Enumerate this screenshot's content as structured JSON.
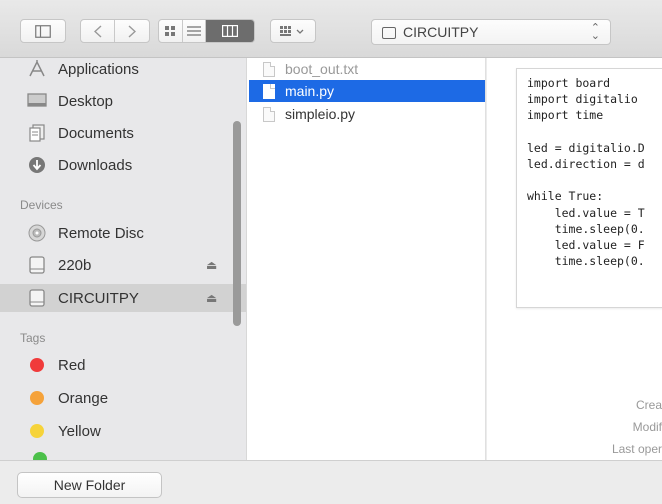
{
  "toolbar": {
    "location": "CIRCUITPY"
  },
  "sidebar": {
    "favorites": [
      {
        "label": "Applications",
        "icon": "applications-icon"
      },
      {
        "label": "Desktop",
        "icon": "desktop-icon"
      },
      {
        "label": "Documents",
        "icon": "documents-icon"
      },
      {
        "label": "Downloads",
        "icon": "downloads-icon"
      }
    ],
    "devices_heading": "Devices",
    "devices": [
      {
        "label": "Remote Disc",
        "icon": "remote-disc-icon"
      },
      {
        "label": "220b",
        "icon": "drive-icon"
      },
      {
        "label": "CIRCUITPY",
        "icon": "drive-icon"
      }
    ],
    "tags_heading": "Tags",
    "tags": [
      {
        "label": "Red",
        "color": "#f03b3b"
      },
      {
        "label": "Orange",
        "color": "#f5a23a"
      },
      {
        "label": "Yellow",
        "color": "#f6d33a"
      }
    ],
    "eject_glyph": "⏏"
  },
  "files": [
    {
      "name": "boot_out.txt"
    },
    {
      "name": "main.py"
    },
    {
      "name": "simpleio.py"
    }
  ],
  "preview": {
    "code": "import board\nimport digitalio\nimport time\n\nled = digitalio.D\nled.direction = d\n\nwhile True:\n    led.value = T\n    time.sleep(0.\n    led.value = F\n    time.sleep(0.",
    "meta": [
      "Crea",
      "Modif",
      "Last oper"
    ]
  },
  "bottom": {
    "new_folder": "New Folder"
  }
}
